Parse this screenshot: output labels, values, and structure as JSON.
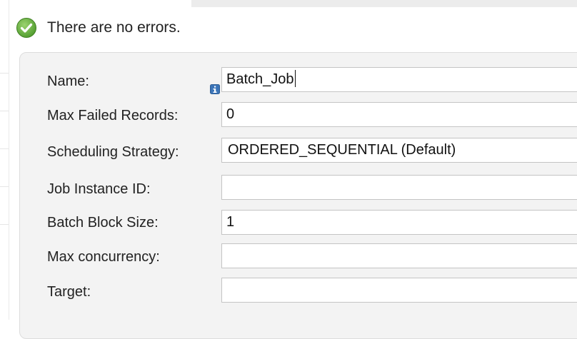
{
  "status": {
    "message": "There are no errors.",
    "icon": "check-circle-icon",
    "icon_color": "#5ca33a"
  },
  "form": {
    "fields": [
      {
        "label": "Name:",
        "value": "Batch_Job",
        "type": "text",
        "has_info_icon": true,
        "focused": true
      },
      {
        "label": "Max Failed Records:",
        "value": "0",
        "type": "text"
      },
      {
        "label": "Scheduling Strategy:",
        "value": "ORDERED_SEQUENTIAL (Default)",
        "type": "select"
      },
      {
        "label": "Job Instance ID:",
        "value": "",
        "type": "text"
      },
      {
        "label": "Batch Block Size:",
        "value": "1",
        "type": "text"
      },
      {
        "label": "Max concurrency:",
        "value": "",
        "type": "text"
      },
      {
        "label": "Target:",
        "value": "",
        "type": "text"
      }
    ]
  },
  "colors": {
    "panel_bg": "#f3f3f3",
    "input_border": "#c4c4c4",
    "info_icon": "#3b74b8"
  }
}
